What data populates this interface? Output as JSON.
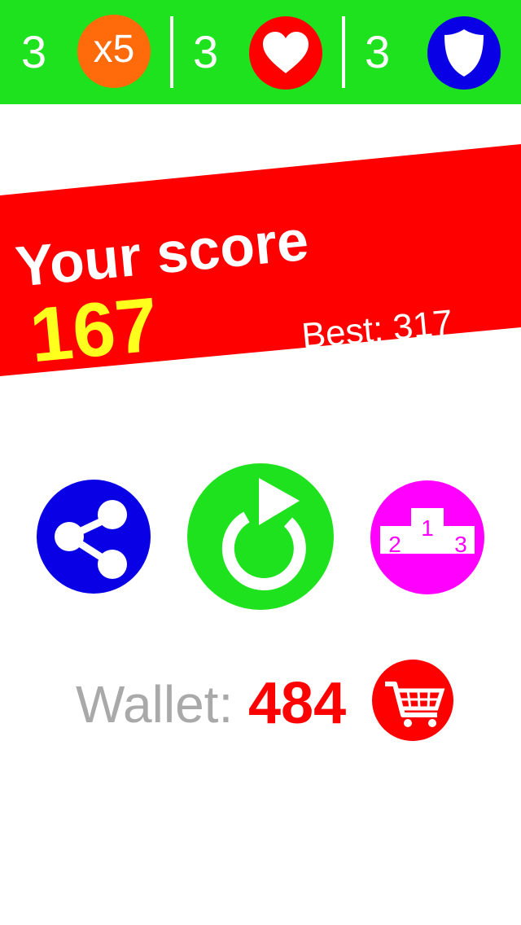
{
  "powerups": [
    {
      "count": "3",
      "icon": "multiplier-icon",
      "label": "x5",
      "color": "#ff6a0a"
    },
    {
      "count": "3",
      "icon": "heart-icon",
      "color": "#ff0000"
    },
    {
      "count": "3",
      "icon": "shield-icon",
      "color": "#0a00e6"
    }
  ],
  "score": {
    "title": "Your score",
    "value": "167",
    "best_label": "Best: 317"
  },
  "actions": {
    "share_icon": "share-icon",
    "replay_icon": "replay-icon",
    "leaderboard_icon": "podium-icon",
    "podium_places": [
      "1",
      "2",
      "3"
    ]
  },
  "wallet": {
    "label": "Wallet:",
    "value": "484",
    "shop_icon": "shopping-cart-icon"
  },
  "colors": {
    "topbar": "#1ee21e",
    "banner": "#ff0000",
    "score_value": "#ffff1e",
    "share": "#0a00e6",
    "replay": "#1ee21e",
    "leaderboard": "#ff00ff",
    "cart": "#ff0000",
    "wallet_label": "#a9a9a9",
    "wallet_value": "#ff0000"
  }
}
